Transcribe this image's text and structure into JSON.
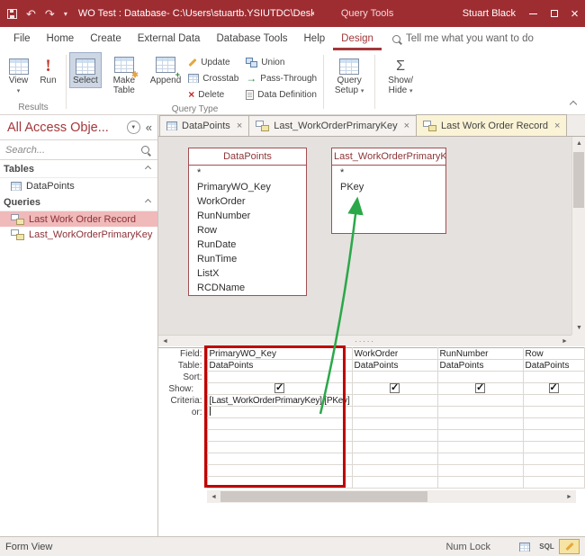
{
  "titlebar": {
    "title": "WO Test : Database- C:\\Users\\stuartb.YSIUTDC\\Desktop...",
    "context_label": "Query Tools",
    "user_name": "Stuart Black"
  },
  "menubar": {
    "items": [
      "File",
      "Home",
      "Create",
      "External Data",
      "Database Tools",
      "Help",
      "Design"
    ],
    "active": "Design",
    "tell_me": "Tell me what you want to do"
  },
  "ribbon": {
    "view": "View",
    "run": "Run",
    "select": "Select",
    "make_table": "Make Table",
    "append": "Append",
    "update": "Update",
    "crosstab": "Crosstab",
    "delete": "Delete",
    "union": "Union",
    "pass_through": "Pass-Through",
    "data_definition": "Data Definition",
    "query_setup": "Query Setup",
    "show_hide": "Show/ Hide",
    "group_results": "Results",
    "group_query_type": "Query Type"
  },
  "nav": {
    "header": "All Access Obje...",
    "search_placeholder": "Search...",
    "sections": [
      {
        "label": "Tables",
        "items": [
          {
            "name": "DataPoints",
            "type": "table"
          }
        ]
      },
      {
        "label": "Queries",
        "items": [
          {
            "name": "Last Work Order Record",
            "type": "query",
            "selected": true
          },
          {
            "name": "Last_WorkOrderPrimaryKey",
            "type": "query",
            "selected": false
          }
        ]
      }
    ]
  },
  "tabs": [
    {
      "label": "DataPoints",
      "active": false
    },
    {
      "label": "Last_WorkOrderPrimaryKey",
      "active": false
    },
    {
      "label": "Last Work Order Record",
      "active": true
    }
  ],
  "designer": {
    "tables": [
      {
        "name": "DataPoints",
        "fields": [
          "*",
          "PrimaryWO_Key",
          "WorkOrder",
          "RunNumber",
          "Row",
          "RunDate",
          "RunTime",
          "ListX",
          "RCDName"
        ]
      },
      {
        "name": "Last_WorkOrderPrimaryKey",
        "fields": [
          "*",
          "PKey"
        ]
      }
    ]
  },
  "grid": {
    "row_labels": [
      "Field:",
      "Table:",
      "Sort:",
      "Show:",
      "Criteria:",
      "or:"
    ],
    "columns": [
      {
        "field": "PrimaryWO_Key",
        "table": "DataPoints",
        "sort": "",
        "show": true,
        "criteria": "[Last_WorkOrderPrimaryKey].[PKey]",
        "or": ""
      },
      {
        "field": "WorkOrder",
        "table": "DataPoints",
        "sort": "",
        "show": true,
        "criteria": "",
        "or": ""
      },
      {
        "field": "RunNumber",
        "table": "DataPoints",
        "sort": "",
        "show": true,
        "criteria": "",
        "or": ""
      },
      {
        "field": "Row",
        "table": "DataPoints",
        "sort": "",
        "show": true,
        "criteria": "",
        "or": ""
      }
    ]
  },
  "statusbar": {
    "view_label": "Form View",
    "num_lock": "Num Lock",
    "sql": "SQL"
  },
  "colors": {
    "titlebar_red": "#9E2D32",
    "accent_red": "#A4373A",
    "annotation_red": "#C00000",
    "annotation_green": "#2BA84A",
    "selected_item_bg": "#F0B9BA",
    "active_tab_bg": "#FAF3D5"
  }
}
